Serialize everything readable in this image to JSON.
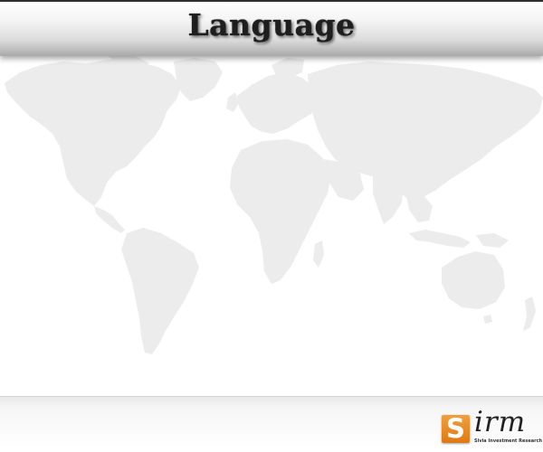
{
  "header": {
    "title": "Language"
  },
  "footer": {
    "logo": {
      "mark_letter": "S",
      "name": "irm",
      "tagline": "Sivia Investment Research Manage"
    }
  },
  "colors": {
    "map_fill": "#ececec",
    "logo_orange": "#e8891f",
    "title_text": "#1e1e1e"
  },
  "icons": {
    "background": "world-map-icon",
    "logo": "sirm-logo-icon"
  }
}
